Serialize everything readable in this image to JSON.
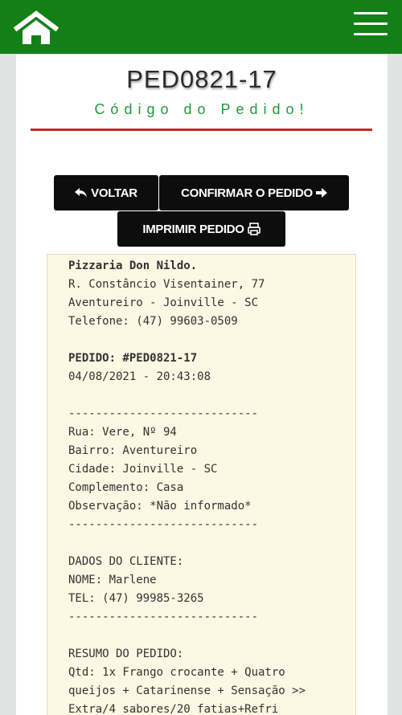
{
  "nav": {
    "home_icon": "home-icon",
    "menu_icon": "hamburger-menu-icon"
  },
  "header": {
    "order_code": "PED0821-17",
    "subtitle": "Código do Pedido!"
  },
  "actions": {
    "back_label": "VOLTAR",
    "confirm_label": "CONFIRMAR O PEDIDO",
    "print_label": "IMPRIMIR PEDIDO"
  },
  "receipt": {
    "store_name": "Pizzaria Don Nildo.",
    "store_address": "R. Constâncio Visentainer, 77",
    "store_city": "Aventureiro - Joinville - SC",
    "store_phone": "Telefone: (47) 99603-0509",
    "order_line": "PEDIDO: #PED0821-17",
    "order_datetime": "04/08/2021 - 20:43:08",
    "separator": "----------------------------",
    "street": "Rua: Vere, Nº 94",
    "district": "Bairro: Aventureiro",
    "city": "Cidade: Joinville - SC",
    "complement": "Complemento: Casa",
    "note": "Observação: *Não informado*",
    "client_header": "DADOS DO CLIENTE:",
    "client_name": "NOME: Marlene",
    "client_phone": "TEL: (47) 99985-3265",
    "summary_header": "RESUMO DO PEDIDO:",
    "summary_line_1": "Qtd: 1x Frango crocante + Quatro",
    "summary_line_2": "queijos + Catarinense + Sensação >>",
    "summary_line_3": "Extra/4 sabores/20 fatias+Refri"
  },
  "colors": {
    "topbar": "#138017",
    "subtitle": "#1f9a3a",
    "divider": "#c62828",
    "button": "#0d0d0d"
  }
}
